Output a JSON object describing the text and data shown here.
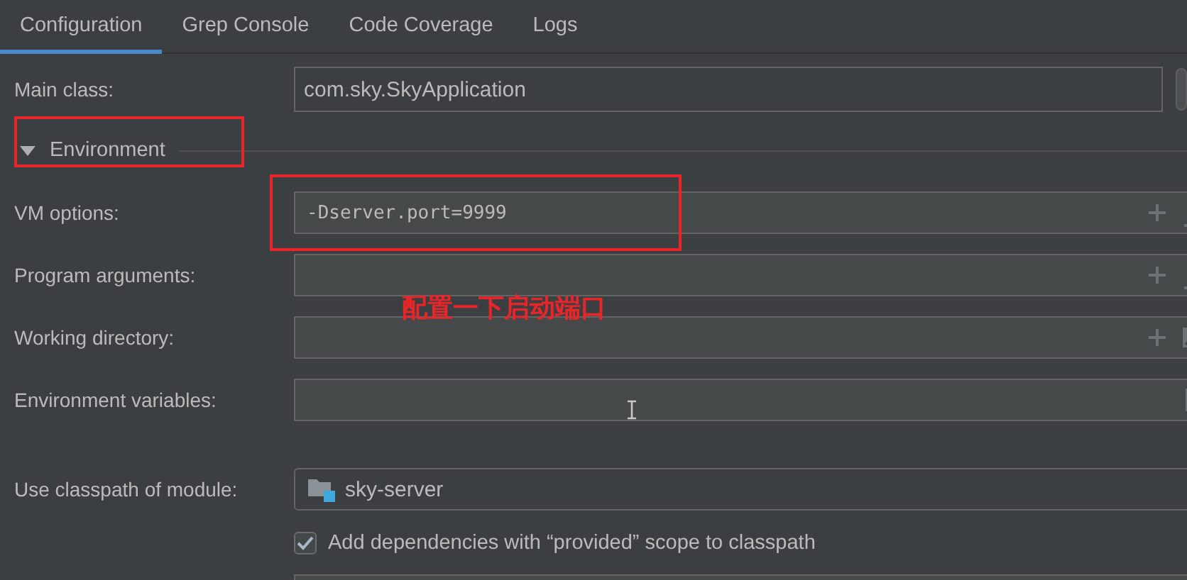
{
  "tabs": [
    {
      "label": "Configuration",
      "selected": true
    },
    {
      "label": "Grep Console",
      "selected": false
    },
    {
      "label": "Code Coverage",
      "selected": false
    },
    {
      "label": "Logs",
      "selected": false
    }
  ],
  "main_class": {
    "label": "Main class:",
    "value": "com.sky.SkyApplication"
  },
  "environment": {
    "label": "Environment",
    "expanded": true,
    "highlighted": true
  },
  "fields": [
    {
      "label": "VM options:",
      "value": "-Dserver.port=9999",
      "kind": "expand",
      "highlighted": true
    },
    {
      "label": "Program arguments:",
      "kind": "expand",
      "highlighted": false
    },
    {
      "label": "Working directory:",
      "kind": "folder",
      "highlighted": false
    },
    {
      "label": "Environment variables:",
      "kind": "browse",
      "highlighted": false
    }
  ],
  "annotation": {
    "text": "配置一下启动端口"
  },
  "module": {
    "label": "Use classpath of module:",
    "value": "sky-server"
  },
  "provided_scope": {
    "label": "Add dependencies with “provided” scope to classpath",
    "checked": true
  }
}
